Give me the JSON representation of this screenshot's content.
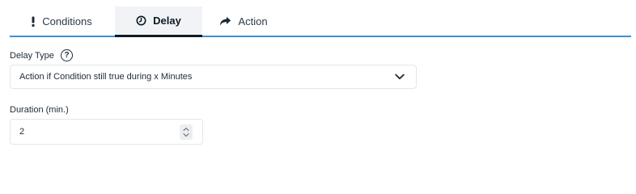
{
  "tabs": [
    {
      "label": "Conditions",
      "icon": "exclamation-icon"
    },
    {
      "label": "Delay",
      "icon": "clock-icon",
      "active": true
    },
    {
      "label": "Action",
      "icon": "share-arrow-icon"
    }
  ],
  "delay_type": {
    "label": "Delay Type",
    "help_icon": "question-circle-icon",
    "help_glyph": "?",
    "selected": "Action if Condition still true during x Minutes"
  },
  "duration": {
    "label": "Duration (min.)",
    "value": "2"
  },
  "colors": {
    "accent": "#3f8fd0",
    "active_tab_bg": "#f1f3f6",
    "text": "#1f2a37"
  }
}
